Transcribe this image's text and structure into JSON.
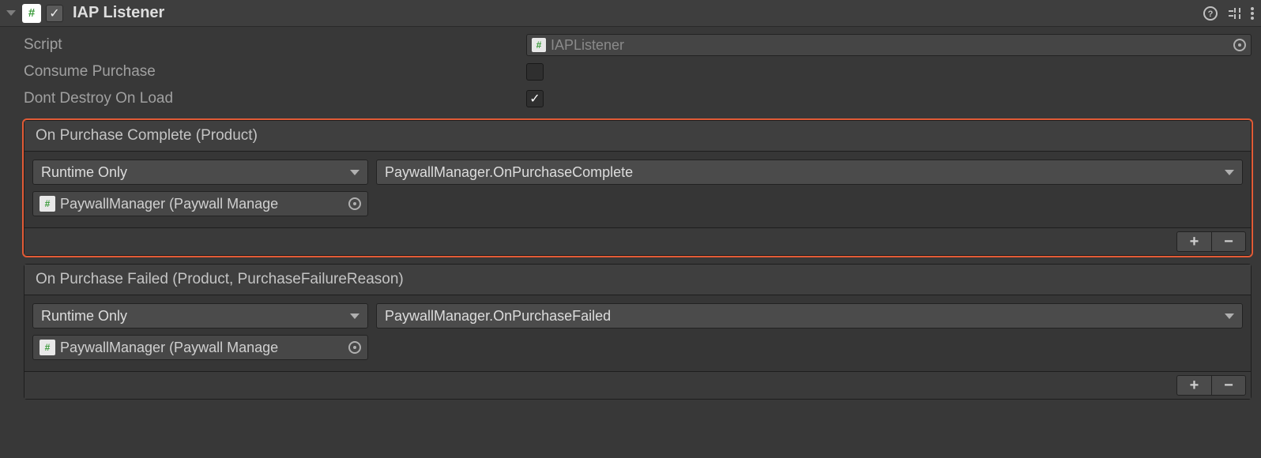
{
  "header": {
    "title": "IAP Listener",
    "enabled_check": "✓"
  },
  "props": {
    "script_label": "Script",
    "script_value": "IAPListener",
    "consume_label": "Consume Purchase",
    "consume_checked": "",
    "ddol_label": "Dont Destroy On Load",
    "ddol_checked": "✓"
  },
  "events": [
    {
      "title": "On Purchase Complete (Product)",
      "mode": "Runtime Only",
      "method": "PaywallManager.OnPurchaseComplete",
      "target": "PaywallManager (Paywall Manage",
      "highlight": true
    },
    {
      "title": "On Purchase Failed (Product, PurchaseFailureReason)",
      "mode": "Runtime Only",
      "method": "PaywallManager.OnPurchaseFailed",
      "target": "PaywallManager (Paywall Manage",
      "highlight": false
    }
  ],
  "icons": {
    "plus": "+",
    "minus": "−",
    "hash": "#"
  }
}
